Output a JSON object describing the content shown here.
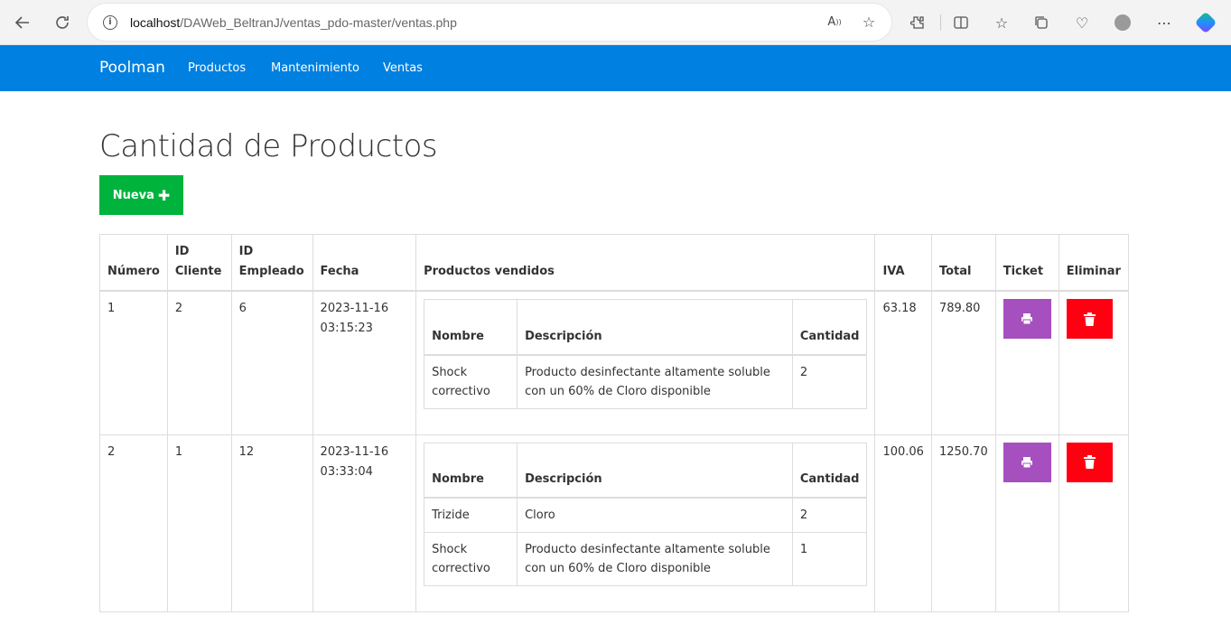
{
  "browser": {
    "url_host": "localhost",
    "url_path": "/DAWeb_BeltranJ/ventas_pdo-master/ventas.php"
  },
  "navbar": {
    "brand": "Poolman",
    "links": [
      "Productos",
      "Mantenimiento",
      "Ventas"
    ]
  },
  "page": {
    "title": "Cantidad de Productos",
    "new_button_label": "Nueva"
  },
  "table": {
    "headers": {
      "numero": "Número",
      "id_cliente": "ID Cliente",
      "id_empleado": "ID Empleado",
      "fecha": "Fecha",
      "productos": "Productos vendidos",
      "iva": "IVA",
      "total": "Total",
      "ticket": "Ticket",
      "eliminar": "Eliminar"
    },
    "inner_headers": {
      "nombre": "Nombre",
      "descripcion": "Descripción",
      "cantidad": "Cantidad"
    },
    "rows": [
      {
        "numero": "1",
        "id_cliente": "2",
        "id_empleado": "6",
        "fecha": "2023-11-16 03:15:23",
        "productos": [
          {
            "nombre": "Shock correctivo",
            "descripcion": "Producto desinfectante altamente soluble con un 60% de Cloro disponible",
            "cantidad": "2"
          }
        ],
        "iva": "63.18",
        "total": "789.80"
      },
      {
        "numero": "2",
        "id_cliente": "1",
        "id_empleado": "12",
        "fecha": "2023-11-16 03:33:04",
        "productos": [
          {
            "nombre": "Trizide",
            "descripcion": "Cloro",
            "cantidad": "2"
          },
          {
            "nombre": "Shock correctivo",
            "descripcion": "Producto desinfectante altamente soluble con un 60% de Cloro disponible",
            "cantidad": "1"
          }
        ],
        "iva": "100.06",
        "total": "1250.70"
      }
    ]
  },
  "colors": {
    "navbar": "#0080e0",
    "new_button": "#00b33c",
    "ticket_button": "#a64fbf",
    "delete_button": "#ff0011"
  },
  "icons": {
    "ticket": "print-icon",
    "delete": "trash-icon",
    "new": "plus-icon"
  }
}
